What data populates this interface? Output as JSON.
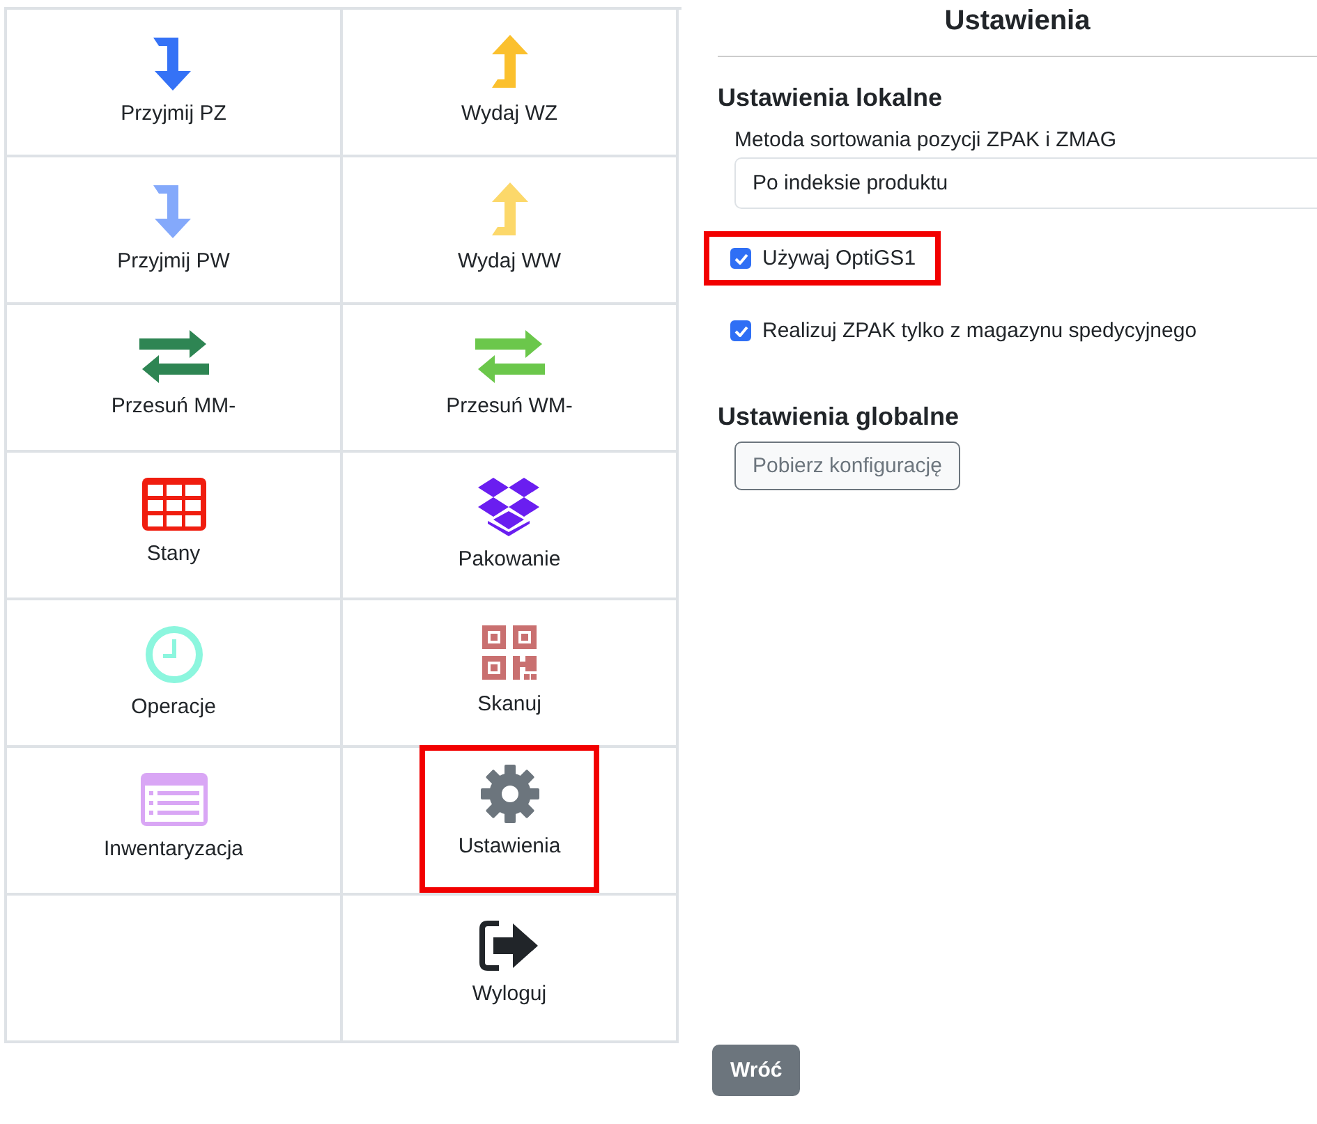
{
  "tiles": [
    {
      "label": "Przyjmij PZ",
      "kind": "arrow-down",
      "color": "#3572f6",
      "highlighted": false
    },
    {
      "label": "Wydaj WZ",
      "kind": "arrow-up",
      "color": "#fbc02d",
      "highlighted": false
    },
    {
      "label": "Przyjmij PW",
      "kind": "arrow-down",
      "color": "#84a9fb",
      "highlighted": false
    },
    {
      "label": "Wydaj WW",
      "kind": "arrow-up",
      "color": "#fcd86a",
      "highlighted": false
    },
    {
      "label": "Przesuń MM-",
      "kind": "swap",
      "color": "#2e8553",
      "highlighted": false
    },
    {
      "label": "Przesuń WM-",
      "kind": "swap",
      "color": "#6bc74b",
      "highlighted": false
    },
    {
      "label": "Stany",
      "kind": "table",
      "color": "#f01d0f",
      "highlighted": false
    },
    {
      "label": "Pakowanie",
      "kind": "boxes",
      "color": "#6a1ef0",
      "highlighted": false
    },
    {
      "label": "Operacje",
      "kind": "clock",
      "color": "#8cf6de",
      "highlighted": false
    },
    {
      "label": "Skanuj",
      "kind": "qr",
      "color": "#c97070",
      "highlighted": false
    },
    {
      "label": "Inwentaryzacja",
      "kind": "list",
      "color": "#d9a6f5",
      "highlighted": false
    },
    {
      "label": "Ustawienia",
      "kind": "gear",
      "color": "#6c757d",
      "highlighted": true
    },
    {
      "kind": "empty"
    },
    {
      "label": "Wyloguj",
      "kind": "logout",
      "color": "#212529",
      "highlighted": false
    }
  ],
  "settings": {
    "title": "Ustawienia",
    "local_heading": "Ustawienia lokalne",
    "sort_label": "Metoda sortowania pozycji ZPAK i ZMAG",
    "sort_value": "Po indeksie produktu",
    "options": [
      {
        "label": "Używaj OptiGS1",
        "checked": true,
        "highlighted": true
      },
      {
        "label": "Realizuj ZPAK tylko z magazynu spedycyjnego",
        "checked": true,
        "highlighted": false
      }
    ],
    "global_heading": "Ustawienia globalne",
    "fetch_button": "Pobierz konfigurację"
  },
  "back_button": "Wróć"
}
